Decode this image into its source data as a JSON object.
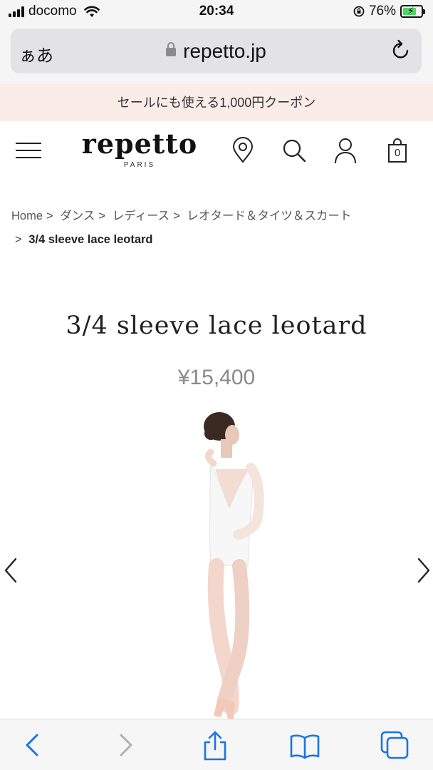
{
  "status_bar": {
    "carrier": "docomo",
    "time": "20:34",
    "battery_percent": "76%",
    "battery_level": 0.76,
    "icons": [
      "signal-icon",
      "wifi-icon",
      "orientation-lock-icon",
      "battery-charging-icon"
    ]
  },
  "browser": {
    "text_size_label": "ぁあ",
    "url": "repetto.jp",
    "icons": [
      "lock-icon",
      "reload-icon"
    ]
  },
  "promo": {
    "text": "セールにも使える1,000円クーポン",
    "background_color": "#fbece8"
  },
  "header": {
    "logo_text": "repetto",
    "logo_subtext": "PARIS",
    "icons": [
      "menu-icon",
      "store-locator-icon",
      "search-icon",
      "account-icon",
      "shopping-bag-icon"
    ],
    "cart_count": "0"
  },
  "breadcrumb": {
    "items": [
      "Home",
      "ダンス",
      "レディース",
      "レオタード＆タイツ＆スカート"
    ],
    "separator": ">",
    "current": "3/4 sleeve lace leotard"
  },
  "product": {
    "title": "3/4 sleeve lace leotard",
    "price": "¥15,400",
    "image_description_icon": "product-photo"
  },
  "carousel": {
    "icons": [
      "chevron-left-icon",
      "chevron-right-icon"
    ]
  },
  "toolbar": {
    "icons": [
      "back-icon",
      "forward-icon",
      "share-icon",
      "bookmarks-icon",
      "tabs-icon"
    ],
    "accent_color": "#1a73e8"
  }
}
